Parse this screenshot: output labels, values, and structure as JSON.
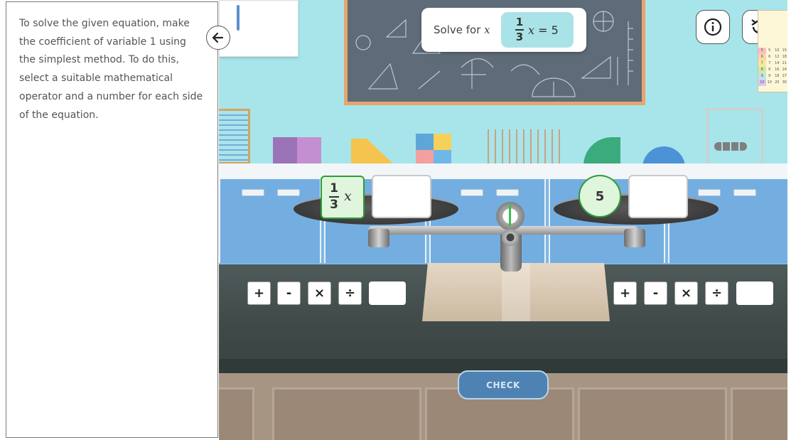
{
  "instructions": {
    "text": "To solve the given equation, make the coefficient of variable 1 using the simplest method. To do this, select a suitable mathematical operator and a number for each side of the equation."
  },
  "task": {
    "label": "Solve for",
    "variable": "x",
    "equation": {
      "numerator": "1",
      "denominator": "3",
      "variable": "x",
      "rhs": "= 5"
    }
  },
  "balance": {
    "left_term": {
      "numerator": "1",
      "denominator": "3",
      "variable": "x"
    },
    "right_term": "5"
  },
  "operators": {
    "plus": "+",
    "minus": "-",
    "times": "×",
    "divide": "÷"
  },
  "buttons": {
    "check": "CHECK"
  },
  "icons": {
    "back": "arrow-left-icon",
    "info": "info-icon",
    "reset": "reset-icon"
  },
  "multiplication_chart": [
    [
      "5",
      "5",
      "10",
      "15"
    ],
    [
      "6",
      "6",
      "12",
      "18"
    ],
    [
      "7",
      "7",
      "14",
      "21"
    ],
    [
      "8",
      "8",
      "16",
      "24"
    ],
    [
      "9",
      "9",
      "18",
      "27"
    ],
    [
      "10",
      "10",
      "20",
      "30"
    ]
  ],
  "colors": {
    "correct_border": "#2e9c3a",
    "check_button": "#4d82b3",
    "board_frame": "#e8a46c"
  }
}
